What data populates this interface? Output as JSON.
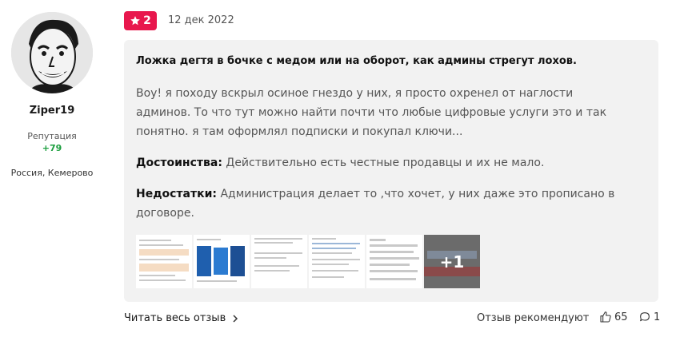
{
  "author": {
    "name": "Ziper19",
    "reputation_label": "Репутация",
    "reputation_value": "+79",
    "location": "Россия, Кемерово"
  },
  "review": {
    "rating": "2",
    "date": "12 дек 2022",
    "title": "Ложка дегтя в бочке с медом или на оборот, как админы стрегут лохов.",
    "text": "Воу! я походу вскрыл осиное гнездо у них, я просто охренел от наглости админов. То что тут можно найти почти что любые цифровые услуги это и так понятно. я там оформлял подписки и покупал ключи...",
    "pros_label": "Достоинства:",
    "pros": "Действительно есть честные продавцы и их не мало.",
    "cons_label": "Недостатки:",
    "cons": "Администрация делает то ,что хочет, у них даже это прописано в договоре.",
    "more_photos": "+1"
  },
  "footer": {
    "read_more": "Читать весь отзыв",
    "recommend_label": "Отзыв рекомендуют",
    "likes": "65",
    "comments": "1"
  },
  "colors": {
    "accent": "#e8174d",
    "reputation": "#1b9e3e",
    "card_bg": "#f2f2f2"
  }
}
